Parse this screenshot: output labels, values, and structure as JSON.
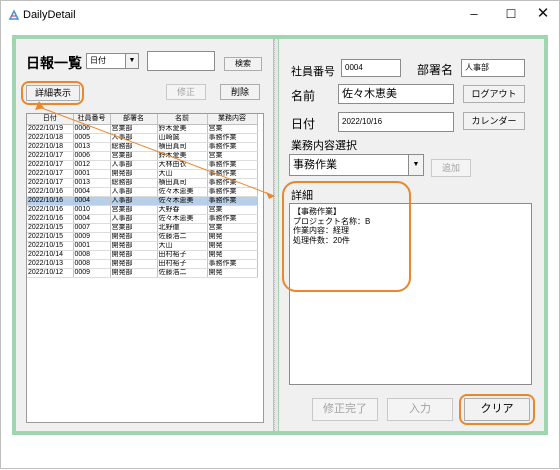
{
  "window": {
    "title": "DailyDetail",
    "minimize": "–",
    "maximize": "☐",
    "close": "✕"
  },
  "left": {
    "heading": "日報一覧",
    "sort_select": "日付",
    "search_value": "",
    "search_button": "検索",
    "detail_button": "詳細表示",
    "edit_button": "修正",
    "delete_button": "削除",
    "table": {
      "columns": [
        "日付",
        "社員番号",
        "部署名",
        "名前",
        "業務内容"
      ],
      "selected_index": 8,
      "rows": [
        [
          "2022/10/19",
          "0006",
          "営業部",
          "鈴木愛美",
          "営業"
        ],
        [
          "2022/10/18",
          "0005",
          "人事部",
          "山崎誠",
          "事務作業"
        ],
        [
          "2022/10/18",
          "0013",
          "総務部",
          "横田真司",
          "事務作業"
        ],
        [
          "2022/10/17",
          "0006",
          "営業部",
          "鈴木愛美",
          "営業"
        ],
        [
          "2022/10/17",
          "0012",
          "人事部",
          "大林由衣",
          "事務作業"
        ],
        [
          "2022/10/17",
          "0001",
          "開発部",
          "大山",
          "事務作業"
        ],
        [
          "2022/10/17",
          "0013",
          "総務部",
          "横田真司",
          "事務作業"
        ],
        [
          "2022/10/16",
          "0004",
          "人事部",
          "佐々木恵美",
          "事務作業"
        ],
        [
          "2022/10/16",
          "0004",
          "人事部",
          "佐々木恵美",
          "事務作業"
        ],
        [
          "2022/10/16",
          "0010",
          "営業部",
          "大野春",
          "営業"
        ],
        [
          "2022/10/16",
          "0004",
          "人事部",
          "佐々木恵美",
          "事務作業"
        ],
        [
          "2022/10/15",
          "0007",
          "営業部",
          "北野徹",
          "営業"
        ],
        [
          "2022/10/15",
          "0009",
          "開発部",
          "佐藤浩二",
          "開発"
        ],
        [
          "2022/10/15",
          "0001",
          "開発部",
          "大山",
          "開発"
        ],
        [
          "2022/10/14",
          "0008",
          "開発部",
          "田村裕子",
          "開発"
        ],
        [
          "2022/10/13",
          "0008",
          "開発部",
          "田村裕子",
          "事務作業"
        ],
        [
          "2022/10/12",
          "0009",
          "開発部",
          "佐藤浩二",
          "開発"
        ]
      ]
    }
  },
  "right": {
    "employee_no_label": "社員番号",
    "employee_no_value": "0004",
    "dept_label": "部署名",
    "dept_value": "人事部",
    "name_label": "名前",
    "name_value": "佐々木恵美",
    "logout_button": "ログアウト",
    "date_label": "日付",
    "date_value": "2022/10/16",
    "calendar_button": "カレンダー",
    "task_select_label": "業務内容選択",
    "task_select_value": "事務作業",
    "add_button": "追加",
    "detail_label": "詳細",
    "detail_text": "【事務作業】\nプロジェクト名称：B\n作業内容：経理\n処理件数：20件",
    "finish_edit_button": "修正完了",
    "input_button": "入力",
    "clear_button": "クリア"
  },
  "colors": {
    "frame": "#9fd6b0",
    "highlight": "#e8872c",
    "selected_row": "#b8cfe9"
  }
}
